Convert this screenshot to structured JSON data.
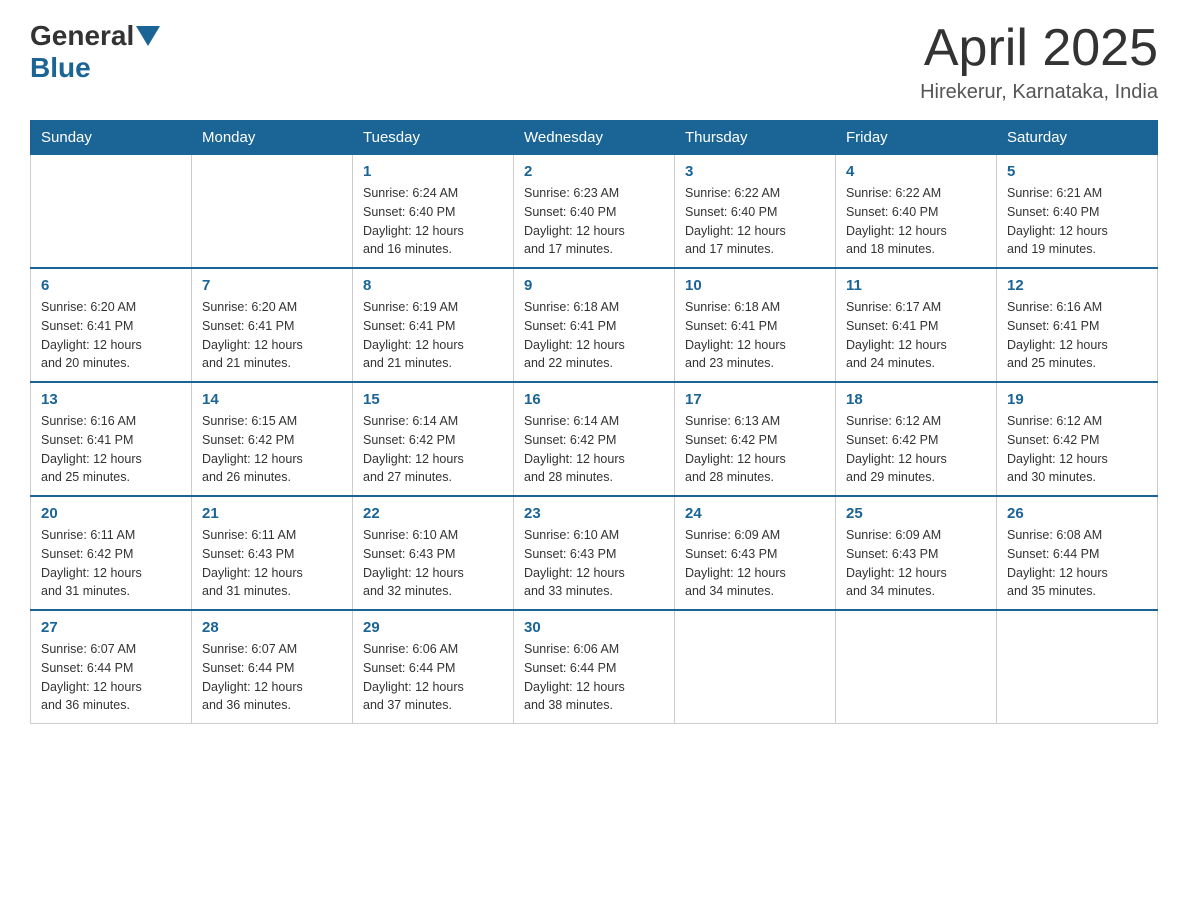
{
  "header": {
    "logo_general": "General",
    "logo_blue": "Blue",
    "month_title": "April 2025",
    "location": "Hirekerur, Karnataka, India"
  },
  "weekdays": [
    "Sunday",
    "Monday",
    "Tuesday",
    "Wednesday",
    "Thursday",
    "Friday",
    "Saturday"
  ],
  "weeks": [
    [
      {
        "day": "",
        "info": ""
      },
      {
        "day": "",
        "info": ""
      },
      {
        "day": "1",
        "info": "Sunrise: 6:24 AM\nSunset: 6:40 PM\nDaylight: 12 hours\nand 16 minutes."
      },
      {
        "day": "2",
        "info": "Sunrise: 6:23 AM\nSunset: 6:40 PM\nDaylight: 12 hours\nand 17 minutes."
      },
      {
        "day": "3",
        "info": "Sunrise: 6:22 AM\nSunset: 6:40 PM\nDaylight: 12 hours\nand 17 minutes."
      },
      {
        "day": "4",
        "info": "Sunrise: 6:22 AM\nSunset: 6:40 PM\nDaylight: 12 hours\nand 18 minutes."
      },
      {
        "day": "5",
        "info": "Sunrise: 6:21 AM\nSunset: 6:40 PM\nDaylight: 12 hours\nand 19 minutes."
      }
    ],
    [
      {
        "day": "6",
        "info": "Sunrise: 6:20 AM\nSunset: 6:41 PM\nDaylight: 12 hours\nand 20 minutes."
      },
      {
        "day": "7",
        "info": "Sunrise: 6:20 AM\nSunset: 6:41 PM\nDaylight: 12 hours\nand 21 minutes."
      },
      {
        "day": "8",
        "info": "Sunrise: 6:19 AM\nSunset: 6:41 PM\nDaylight: 12 hours\nand 21 minutes."
      },
      {
        "day": "9",
        "info": "Sunrise: 6:18 AM\nSunset: 6:41 PM\nDaylight: 12 hours\nand 22 minutes."
      },
      {
        "day": "10",
        "info": "Sunrise: 6:18 AM\nSunset: 6:41 PM\nDaylight: 12 hours\nand 23 minutes."
      },
      {
        "day": "11",
        "info": "Sunrise: 6:17 AM\nSunset: 6:41 PM\nDaylight: 12 hours\nand 24 minutes."
      },
      {
        "day": "12",
        "info": "Sunrise: 6:16 AM\nSunset: 6:41 PM\nDaylight: 12 hours\nand 25 minutes."
      }
    ],
    [
      {
        "day": "13",
        "info": "Sunrise: 6:16 AM\nSunset: 6:41 PM\nDaylight: 12 hours\nand 25 minutes."
      },
      {
        "day": "14",
        "info": "Sunrise: 6:15 AM\nSunset: 6:42 PM\nDaylight: 12 hours\nand 26 minutes."
      },
      {
        "day": "15",
        "info": "Sunrise: 6:14 AM\nSunset: 6:42 PM\nDaylight: 12 hours\nand 27 minutes."
      },
      {
        "day": "16",
        "info": "Sunrise: 6:14 AM\nSunset: 6:42 PM\nDaylight: 12 hours\nand 28 minutes."
      },
      {
        "day": "17",
        "info": "Sunrise: 6:13 AM\nSunset: 6:42 PM\nDaylight: 12 hours\nand 28 minutes."
      },
      {
        "day": "18",
        "info": "Sunrise: 6:12 AM\nSunset: 6:42 PM\nDaylight: 12 hours\nand 29 minutes."
      },
      {
        "day": "19",
        "info": "Sunrise: 6:12 AM\nSunset: 6:42 PM\nDaylight: 12 hours\nand 30 minutes."
      }
    ],
    [
      {
        "day": "20",
        "info": "Sunrise: 6:11 AM\nSunset: 6:42 PM\nDaylight: 12 hours\nand 31 minutes."
      },
      {
        "day": "21",
        "info": "Sunrise: 6:11 AM\nSunset: 6:43 PM\nDaylight: 12 hours\nand 31 minutes."
      },
      {
        "day": "22",
        "info": "Sunrise: 6:10 AM\nSunset: 6:43 PM\nDaylight: 12 hours\nand 32 minutes."
      },
      {
        "day": "23",
        "info": "Sunrise: 6:10 AM\nSunset: 6:43 PM\nDaylight: 12 hours\nand 33 minutes."
      },
      {
        "day": "24",
        "info": "Sunrise: 6:09 AM\nSunset: 6:43 PM\nDaylight: 12 hours\nand 34 minutes."
      },
      {
        "day": "25",
        "info": "Sunrise: 6:09 AM\nSunset: 6:43 PM\nDaylight: 12 hours\nand 34 minutes."
      },
      {
        "day": "26",
        "info": "Sunrise: 6:08 AM\nSunset: 6:44 PM\nDaylight: 12 hours\nand 35 minutes."
      }
    ],
    [
      {
        "day": "27",
        "info": "Sunrise: 6:07 AM\nSunset: 6:44 PM\nDaylight: 12 hours\nand 36 minutes."
      },
      {
        "day": "28",
        "info": "Sunrise: 6:07 AM\nSunset: 6:44 PM\nDaylight: 12 hours\nand 36 minutes."
      },
      {
        "day": "29",
        "info": "Sunrise: 6:06 AM\nSunset: 6:44 PM\nDaylight: 12 hours\nand 37 minutes."
      },
      {
        "day": "30",
        "info": "Sunrise: 6:06 AM\nSunset: 6:44 PM\nDaylight: 12 hours\nand 38 minutes."
      },
      {
        "day": "",
        "info": ""
      },
      {
        "day": "",
        "info": ""
      },
      {
        "day": "",
        "info": ""
      }
    ]
  ]
}
